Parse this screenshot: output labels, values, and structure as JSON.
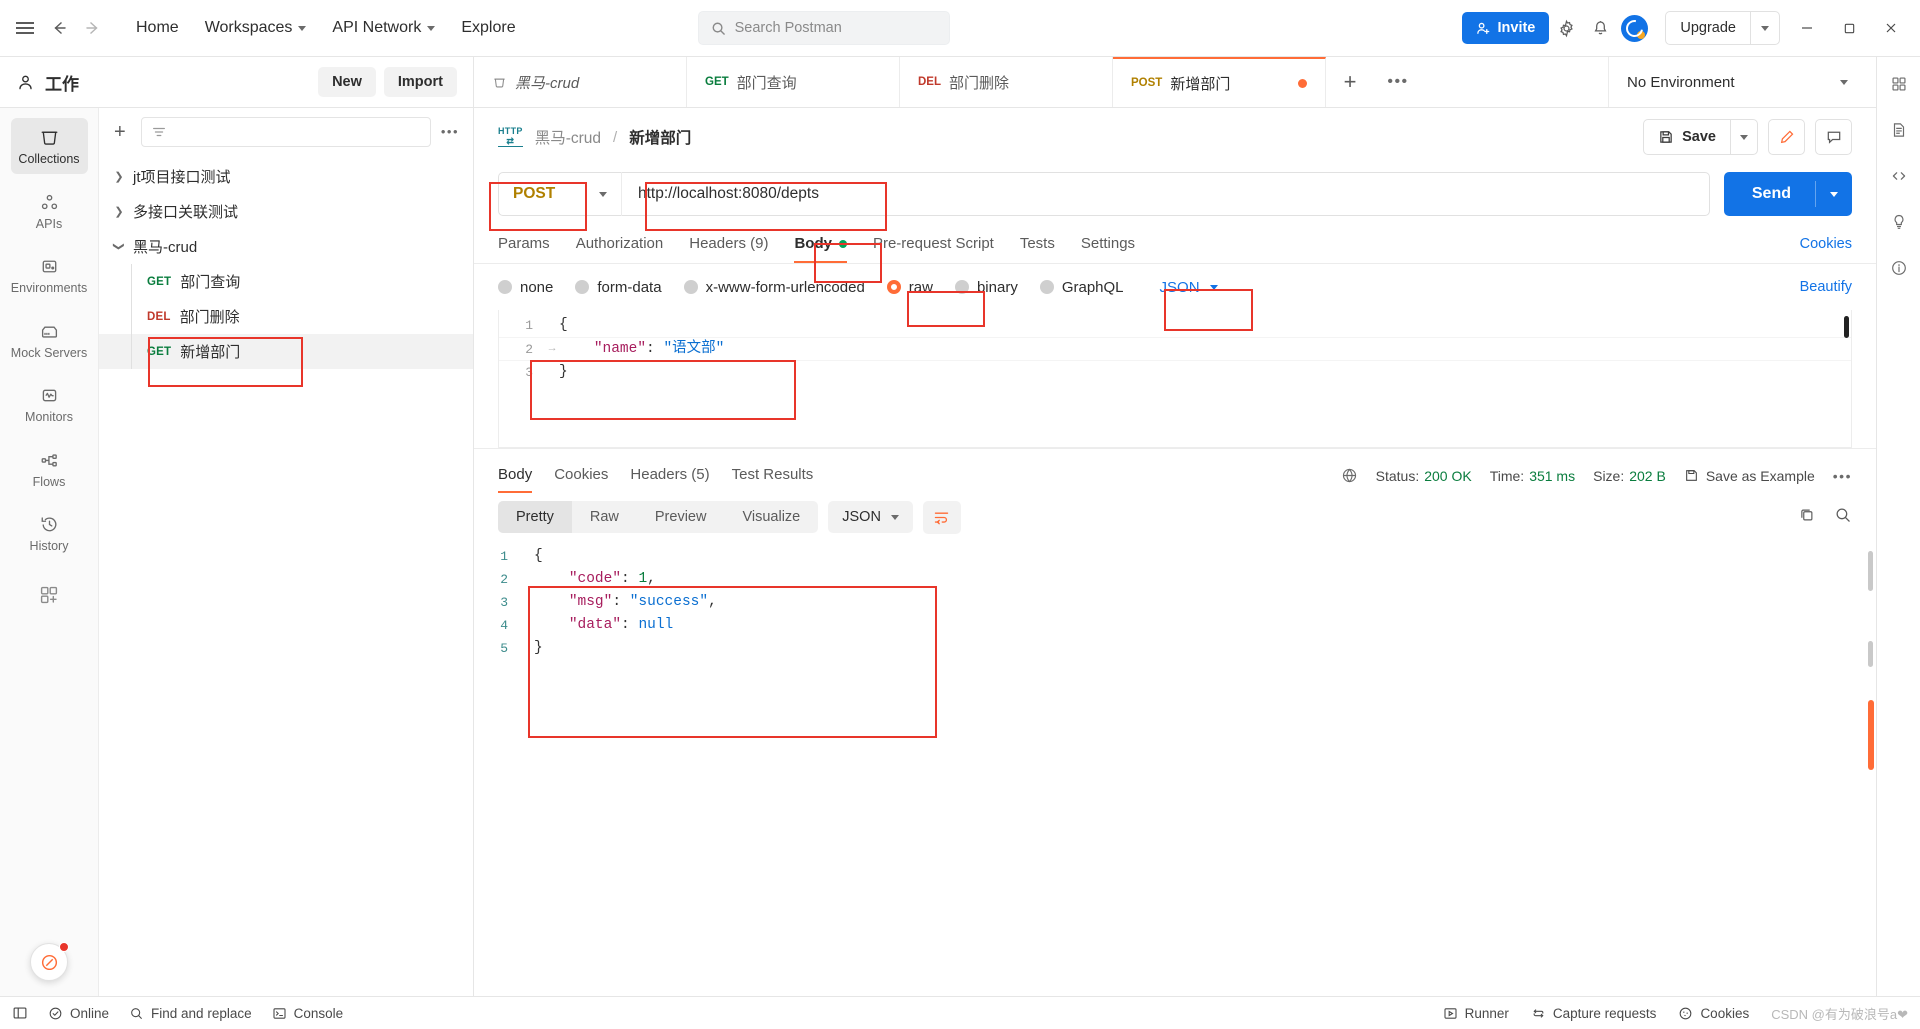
{
  "topbar": {
    "menu_icon": "hamburger-icon",
    "back_icon": "arrow-left-icon",
    "forward_icon": "arrow-right-icon",
    "home": "Home",
    "workspaces": "Workspaces",
    "api_network": "API Network",
    "explore": "Explore",
    "search_placeholder": "Search Postman",
    "invite": "Invite",
    "settings_icon": "gear-icon",
    "notifications_icon": "bell-icon",
    "account_icon": "account-avatar-icon",
    "upgrade": "Upgrade",
    "minimize": "minimize-icon",
    "maximize": "maximize-icon",
    "close": "close-icon"
  },
  "workspace": {
    "name": "工作",
    "new_label": "New",
    "import_label": "Import"
  },
  "rail": {
    "items": [
      {
        "label": "Collections",
        "icon": "collections-icon",
        "active": true
      },
      {
        "label": "APIs",
        "icon": "apis-icon",
        "active": false
      },
      {
        "label": "Environments",
        "icon": "environments-icon",
        "active": false
      },
      {
        "label": "Mock Servers",
        "icon": "mock-servers-icon",
        "active": false
      },
      {
        "label": "Monitors",
        "icon": "monitors-icon",
        "active": false
      },
      {
        "label": "Flows",
        "icon": "flows-icon",
        "active": false
      },
      {
        "label": "History",
        "icon": "history-icon",
        "active": false
      }
    ],
    "add_label": "+"
  },
  "sidebar": {
    "filter_placeholder": "",
    "tree": [
      {
        "type": "collection",
        "name": "jt项目接口测试",
        "expanded": false
      },
      {
        "type": "collection",
        "name": "多接口关联测试",
        "expanded": false
      },
      {
        "type": "collection",
        "name": "黑马-crud",
        "expanded": true,
        "children": [
          {
            "method": "GET",
            "name": "部门查询",
            "selected": false
          },
          {
            "method": "DEL",
            "name": "部门删除",
            "selected": false
          },
          {
            "method": "GET",
            "name": "新增部门",
            "selected": true
          }
        ]
      }
    ]
  },
  "tabs": {
    "items": [
      {
        "icon": "collection-icon",
        "method": "",
        "name": "黑马-crud",
        "active": false,
        "dirty": false
      },
      {
        "icon": "",
        "method": "GET",
        "name": "部门查询",
        "active": false,
        "dirty": false
      },
      {
        "icon": "",
        "method": "DEL",
        "name": "部门删除",
        "active": false,
        "dirty": false
      },
      {
        "icon": "",
        "method": "POST",
        "name": "新增部门",
        "active": true,
        "dirty": true
      }
    ],
    "add_icon": "plus-icon",
    "more_icon": "more-icon",
    "environment": "No Environment"
  },
  "breadcrumb": {
    "protocol_badge": "HTTP",
    "collection": "黑马-crud",
    "separator": "/",
    "request": "新增部门",
    "save_label": "Save",
    "save_icon": "save-icon",
    "edit_icon": "pencil-icon",
    "comment_icon": "comment-icon"
  },
  "request": {
    "method": "POST",
    "url": "http://localhost:8080/depts",
    "send_label": "Send",
    "tabs": [
      {
        "label": "Params",
        "active": false,
        "dot": false
      },
      {
        "label": "Authorization",
        "active": false,
        "dot": false
      },
      {
        "label": "Headers (9)",
        "active": false,
        "dot": false
      },
      {
        "label": "Body",
        "active": true,
        "dot": true
      },
      {
        "label": "Pre-request Script",
        "active": false,
        "dot": false
      },
      {
        "label": "Tests",
        "active": false,
        "dot": false
      },
      {
        "label": "Settings",
        "active": false,
        "dot": false
      }
    ],
    "cookies_link": "Cookies",
    "body_types": [
      {
        "label": "none",
        "selected": false
      },
      {
        "label": "form-data",
        "selected": false
      },
      {
        "label": "x-www-form-urlencoded",
        "selected": false
      },
      {
        "label": "raw",
        "selected": true
      },
      {
        "label": "binary",
        "selected": false
      },
      {
        "label": "GraphQL",
        "selected": false
      }
    ],
    "raw_format": "JSON",
    "beautify_label": "Beautify",
    "body_lines": [
      {
        "no": "1",
        "fold": "",
        "tokens": [
          {
            "t": "{",
            "c": "p"
          }
        ]
      },
      {
        "no": "2",
        "fold": "→",
        "tokens": [
          {
            "t": "    ",
            "c": "p"
          },
          {
            "t": "\"name\"",
            "c": "k"
          },
          {
            "t": ": ",
            "c": "p"
          },
          {
            "t": "\"语文部\"",
            "c": "s"
          }
        ]
      },
      {
        "no": "3",
        "fold": "",
        "tokens": [
          {
            "t": "}",
            "c": "p"
          }
        ]
      }
    ]
  },
  "response": {
    "tabs": [
      {
        "label": "Body",
        "active": true
      },
      {
        "label": "Cookies",
        "active": false
      },
      {
        "label": "Headers (5)",
        "active": false
      },
      {
        "label": "Test Results",
        "active": false
      }
    ],
    "globe_icon": "globe-icon",
    "status_label": "Status:",
    "status_value": "200 OK",
    "time_label": "Time:",
    "time_value": "351 ms",
    "size_label": "Size:",
    "size_value": "202 B",
    "save_example": "Save as Example",
    "more_icon": "more-icon",
    "views": [
      {
        "label": "Pretty",
        "active": true
      },
      {
        "label": "Raw",
        "active": false
      },
      {
        "label": "Preview",
        "active": false
      },
      {
        "label": "Visualize",
        "active": false
      }
    ],
    "format": "JSON",
    "wrap_icon": "wrap-lines-icon",
    "copy_icon": "copy-icon",
    "search_icon": "search-icon",
    "body_lines": [
      {
        "no": "1",
        "tokens": [
          {
            "t": "{",
            "c": "p"
          }
        ]
      },
      {
        "no": "2",
        "tokens": [
          {
            "t": "    ",
            "c": "p"
          },
          {
            "t": "\"code\"",
            "c": "k"
          },
          {
            "t": ": ",
            "c": "p"
          },
          {
            "t": "1",
            "c": "n"
          },
          {
            "t": ",",
            "c": "p"
          }
        ]
      },
      {
        "no": "3",
        "tokens": [
          {
            "t": "    ",
            "c": "p"
          },
          {
            "t": "\"msg\"",
            "c": "k"
          },
          {
            "t": ": ",
            "c": "p"
          },
          {
            "t": "\"success\"",
            "c": "s"
          },
          {
            "t": ",",
            "c": "p"
          }
        ]
      },
      {
        "no": "4",
        "tokens": [
          {
            "t": "    ",
            "c": "p"
          },
          {
            "t": "\"data\"",
            "c": "k"
          },
          {
            "t": ": ",
            "c": "p"
          },
          {
            "t": "null",
            "c": "nul"
          }
        ]
      },
      {
        "no": "5",
        "tokens": [
          {
            "t": "}",
            "c": "p"
          }
        ]
      }
    ]
  },
  "statusbar": {
    "layout_icon": "layout-icon",
    "online": "Online",
    "find_replace": "Find and replace",
    "console": "Console",
    "runner": "Runner",
    "capture": "Capture requests",
    "cookies": "Cookies",
    "watermark": "CSDN @有为破浪号a❤"
  },
  "rightrail": {
    "icons": [
      "grid-icon",
      "document-icon",
      "code-icon",
      "bulb-icon",
      "info-icon"
    ]
  },
  "colors": {
    "accent": "#ff6c37",
    "blue": "#1273e6",
    "get": "#0a7d3e",
    "delete": "#c0392b",
    "post": "#b08000",
    "annotation": "#e8352a"
  }
}
